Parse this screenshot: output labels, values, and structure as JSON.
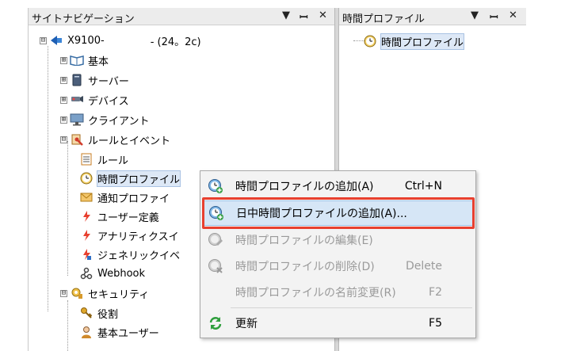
{
  "colors": {
    "highlight": "#e8402f",
    "selection": "#dde8f6"
  },
  "left_pane": {
    "title": "サイトナビゲーション",
    "controls": [
      "▼",
      "ꟷ",
      "✕"
    ],
    "tree": [
      {
        "label": "X9100-",
        "icon": "server-root-icon",
        "expander": "⊟"
      },
      {
        "label": "- (24。2c)"
      },
      {
        "label": "基本",
        "icon": "book-icon",
        "expander": "⊞"
      },
      {
        "label": "サーバー",
        "icon": "server-icon",
        "expander": "⊞"
      },
      {
        "label": "デバイス",
        "icon": "camera-icon",
        "expander": "⊞"
      },
      {
        "label": "クライアント",
        "icon": "monitor-icon",
        "expander": "⊞"
      },
      {
        "label": "ルールとイベント",
        "icon": "rules-icon",
        "expander": "⊟"
      },
      {
        "label": "ルール",
        "icon": "list-icon"
      },
      {
        "label": "時間プロファイル",
        "icon": "clock-icon"
      },
      {
        "label": "通知プロファイ",
        "icon": "mail-icon"
      },
      {
        "label": "ユーザー定義",
        "icon": "lightning-icon"
      },
      {
        "label": "アナリティクスイ",
        "icon": "lightning-icon"
      },
      {
        "label": "ジェネリックイベ",
        "icon": "lightning-icon"
      },
      {
        "label": "Webhook",
        "icon": "webhook-icon"
      },
      {
        "label": "セキュリティ",
        "icon": "security-icon",
        "expander": "⊟"
      },
      {
        "label": "役割",
        "icon": "key-icon"
      },
      {
        "label": "基本ユーザー",
        "icon": "user-icon"
      }
    ]
  },
  "right_pane": {
    "title": "時間プロファイル",
    "controls": [
      "▼",
      "ꟷ",
      "✕"
    ],
    "tree": [
      {
        "label": "時間プロファイル",
        "icon": "clock-icon"
      }
    ]
  },
  "context_menu": {
    "items": [
      {
        "label": "時間プロファイルの追加(A)",
        "shortcut": "Ctrl+N",
        "enabled": true
      },
      {
        "label": "日中時間プロファイルの追加(A)...",
        "shortcut": "",
        "enabled": true,
        "highlighted": true
      },
      {
        "label": "時間プロファイルの編集(E)",
        "shortcut": "",
        "enabled": false
      },
      {
        "label": "時間プロファイルの削除(D)",
        "shortcut": "Delete",
        "enabled": false
      },
      {
        "label": "時間プロファイルの名前変更(R)",
        "shortcut": "F2",
        "enabled": false
      },
      {
        "label": "更新",
        "shortcut": "F5",
        "enabled": true
      }
    ]
  }
}
